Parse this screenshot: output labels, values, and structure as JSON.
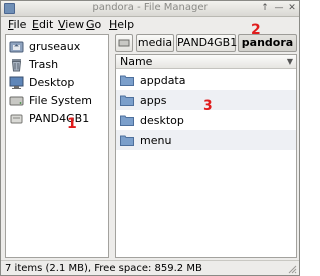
{
  "window": {
    "title": "pandora - File Manager"
  },
  "menubar": {
    "items": [
      {
        "mnemonic": "F",
        "rest": "ile"
      },
      {
        "mnemonic": "E",
        "rest": "dit"
      },
      {
        "mnemonic": "V",
        "rest": "iew"
      },
      {
        "mnemonic": "G",
        "rest": "o"
      },
      {
        "mnemonic": "H",
        "rest": "elp"
      }
    ]
  },
  "sidebar": {
    "places": [
      {
        "label": "gruseaux",
        "icon": "home-folder-icon"
      },
      {
        "label": "Trash",
        "icon": "trash-icon"
      },
      {
        "label": "Desktop",
        "icon": "desktop-icon"
      },
      {
        "label": "File System",
        "icon": "harddrive-icon"
      },
      {
        "label": "PAND4GB1",
        "icon": "removable-drive-icon"
      }
    ]
  },
  "pathbar": {
    "buttons": [
      {
        "label": "media",
        "active": false
      },
      {
        "label": "PAND4GB1",
        "active": false
      },
      {
        "label": "pandora",
        "active": true
      }
    ]
  },
  "filelist": {
    "column_header": "Name",
    "files": [
      {
        "name": "appdata",
        "icon": "folder-icon"
      },
      {
        "name": "apps",
        "icon": "folder-icon"
      },
      {
        "name": "desktop",
        "icon": "folder-icon"
      },
      {
        "name": "menu",
        "icon": "folder-icon"
      }
    ]
  },
  "statusbar": {
    "text": "7 items (2.1 MB), Free space: 859.2 MB"
  },
  "annotations": [
    "1",
    "2",
    "3"
  ],
  "colors": {
    "annotation": "#e01c1c",
    "folder": "#7b9fcb",
    "alt_row": "#eef0f4"
  }
}
